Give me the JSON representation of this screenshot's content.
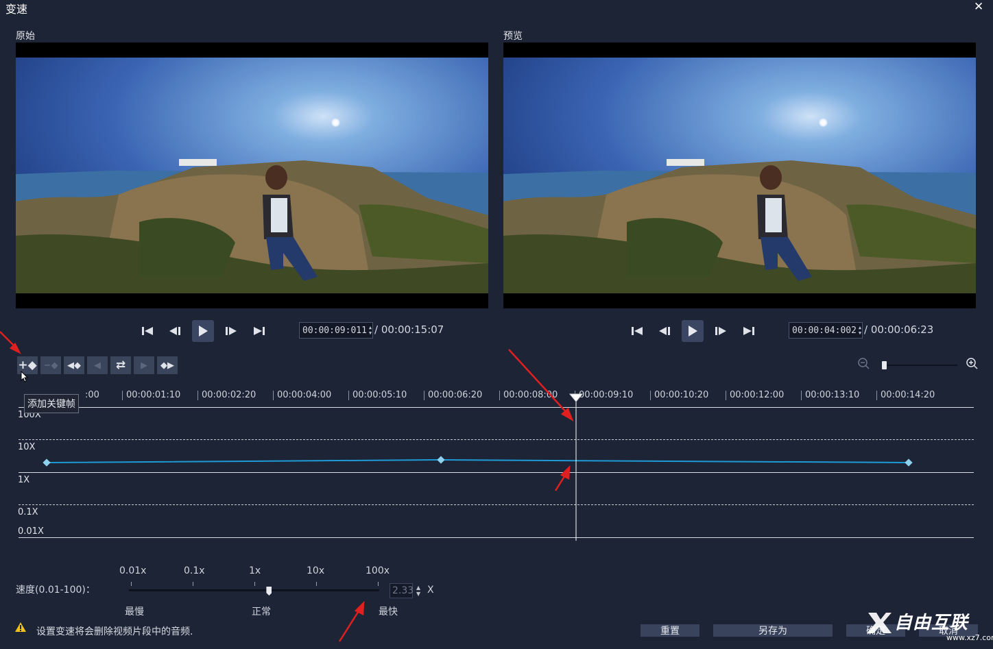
{
  "window": {
    "title": "变速",
    "close_glyph": "✕"
  },
  "panels": {
    "original": {
      "label": "原始",
      "current_time": "00:00:09:011",
      "duration": "/ 00:00:15:07"
    },
    "preview": {
      "label": "预览",
      "current_time": "00:00:04:002",
      "duration": "/ 00:00:06:23"
    }
  },
  "toolbar": {
    "tooltip": "添加关键帧",
    "buttons": [
      "add-keyframe",
      "remove-keyframe",
      "previous-keyframe",
      "go-previous",
      "reverse",
      "go-next",
      "next-keyframe"
    ]
  },
  "timeline": {
    "ruler": [
      ":00",
      "00:00:01:10",
      "00:00:02:20",
      "00:00:04:00",
      "00:00:05:10",
      "00:00:06:20",
      "00:00:08:00",
      "00:00:09:10",
      "00:00:10:20",
      "00:00:12:00",
      "00:00:13:10",
      "00:00:14:20"
    ],
    "axis": [
      "100X",
      "10X",
      "1X",
      "0.1X",
      "0.01X"
    ],
    "curve_color": "#1e9bd7"
  },
  "speed": {
    "label": "速度(0.01-100)：",
    "scale": [
      "0.01x",
      "0.1x",
      "1x",
      "10x",
      "100x"
    ],
    "slow_label": "最慢",
    "normal_label": "正常",
    "fast_label": "最快",
    "value": "2.33",
    "unit": "X",
    "slider_position": 0.56
  },
  "footer": {
    "warning": "设置变速将会删除视频片段中的音频.",
    "reset": "重置",
    "save_as": "另存为",
    "ok": "确定",
    "cancel": "取消"
  },
  "watermark": {
    "text": "自由互联",
    "url": "www.xz7.com"
  },
  "colors": {
    "background": "#1c2436",
    "accent": "#1e9bd7",
    "annotation": "#e02020"
  }
}
